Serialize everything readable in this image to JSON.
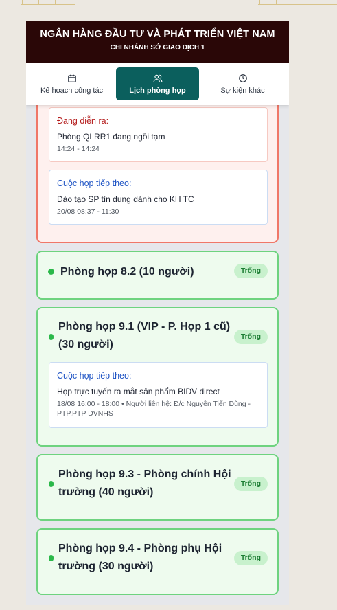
{
  "header": {
    "title": "NGÂN HÀNG ĐẦU TƯ VÀ PHÁT TRIỂN VIỆT NAM",
    "subtitle": "CHI NHÁNH SỞ GIAO DỊCH 1"
  },
  "tabs": [
    {
      "label": "Kế hoạch công tác",
      "icon": "calendar-icon",
      "active": false
    },
    {
      "label": "Lịch phòng họp",
      "icon": "users-icon",
      "active": true
    },
    {
      "label": "Sự kiện khác",
      "icon": "clock-icon",
      "active": false
    }
  ],
  "rooms": [
    {
      "ongoing": {
        "label": "Đang diễn ra:",
        "title": "Phòng QLRR1 đang ngồi tạm",
        "time": "14:24 - 14:24"
      },
      "next": {
        "label": "Cuộc họp tiếp theo:",
        "title": "Đào tạo SP tín dụng dành cho KH TC",
        "time": "20/08 08:37 - 11:30"
      }
    },
    {
      "name": "Phòng họp 8.2 (10 người)",
      "status": "Trống"
    },
    {
      "name_line1": "Phòng họp 9.1 (VIP - P. Họp 1 cũ)",
      "name_line2": "(30 người)",
      "status": "Trống",
      "next": {
        "label": "Cuộc họp tiếp theo:",
        "title": "Họp trực tuyến ra mắt sản phẩm BIDV direct",
        "detail_line1": "18/08 16:00 - 18:00 • Người liên hệ: Đ/c Nguyễn Tiến Dũng -",
        "detail_line2": "PTP.PTP DVNHS"
      }
    },
    {
      "name_line1": "Phòng họp 9.3 - Phòng chính Hội",
      "name_line2": "trường (40 người)",
      "status": "Trống"
    },
    {
      "name_line1": "Phòng họp 9.4 - Phòng phụ Hội",
      "name_line2": "trường (30 người)",
      "status": "Trống"
    }
  ],
  "colors": {
    "header_bg": "#2a0707",
    "active_tab": "#0b5f5d",
    "busy_border": "#f07768",
    "free_border": "#6ed37f",
    "free_dot": "#2bb84a",
    "badge_bg": "#c8f1cd"
  }
}
